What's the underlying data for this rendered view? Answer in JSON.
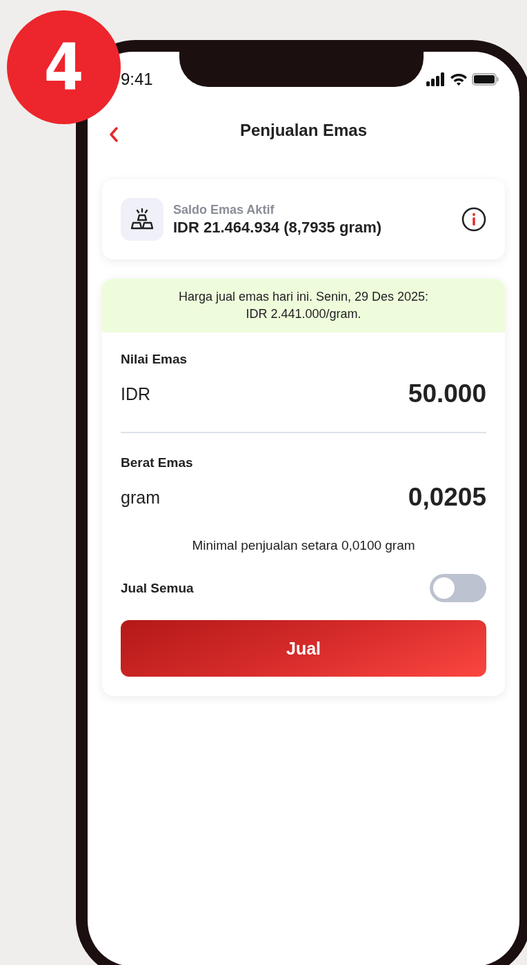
{
  "step_badge": "4",
  "status_bar": {
    "time": "9:41"
  },
  "header": {
    "title": "Penjualan Emas"
  },
  "balance": {
    "label": "Saldo Emas Aktif",
    "value": "IDR 21.464.934 (8,7935 gram)"
  },
  "price_notice": {
    "line_1": "Harga jual emas hari ini. Senin, 29 Des 2025:",
    "line_2": "IDR 2.441.000/gram."
  },
  "fields": [
    {
      "label": "Nilai Emas",
      "unit": "IDR",
      "value": "50.000"
    },
    {
      "label": "Berat Emas",
      "unit": "gram",
      "value": "0,0205"
    }
  ],
  "minimum_note": "Minimal penjualan setara 0,0100 gram",
  "sell_all": {
    "label": "Jual Semua",
    "on": false
  },
  "sell_button": "Jual"
}
